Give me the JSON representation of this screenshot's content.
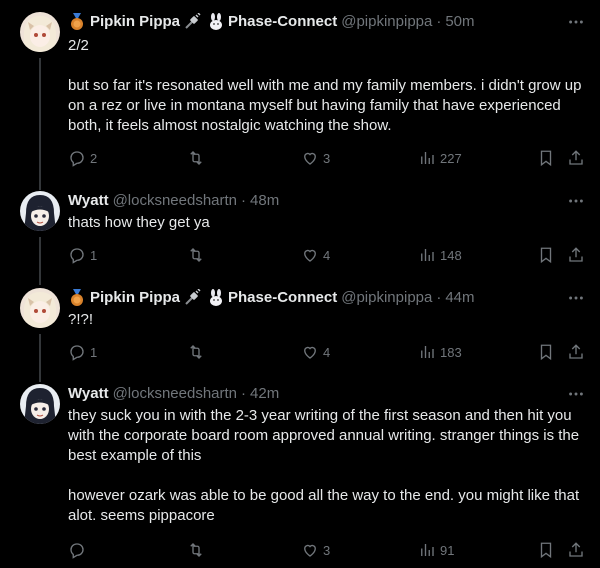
{
  "tweets": [
    {
      "author": "Pipkin Pippa",
      "affiliation": "Phase-Connect",
      "handle": "@pipkinpippa",
      "time": "50m",
      "lines": [
        "2/2",
        "",
        "but so far it's resonated well with me and my family members. i didn't grow up on a rez or live in montana myself but having family that have experienced both, it feels almost nostalgic watching the show."
      ],
      "replies": "2",
      "retweets": "",
      "likes": "3",
      "views": "227"
    },
    {
      "author": "Wyatt",
      "handle": "@locksneedshartn",
      "time": "48m",
      "lines": [
        "thats how they get ya"
      ],
      "replies": "1",
      "retweets": "",
      "likes": "4",
      "views": "148"
    },
    {
      "author": "Pipkin Pippa",
      "affiliation": "Phase-Connect",
      "handle": "@pipkinpippa",
      "time": "44m",
      "lines": [
        "?!?!"
      ],
      "replies": "1",
      "retweets": "",
      "likes": "4",
      "views": "183"
    },
    {
      "author": "Wyatt",
      "handle": "@locksneedshartn",
      "time": "42m",
      "lines": [
        "they suck you in with the 2-3 year writing of the first season and then hit you with the corporate board room approved annual writing. stranger things is the best example of this",
        "",
        "however ozark was able to be good all the way to the end. you might like that alot. seems pippacore"
      ],
      "replies": "",
      "retweets": "",
      "likes": "3",
      "views": "91"
    }
  ],
  "separator": "·",
  "icons": {
    "medal": "medal-emoji",
    "plug": "plug-emoji",
    "rabbit": "rabbit-emoji",
    "more": "more-icon",
    "reply": "reply-icon",
    "retweet": "retweet-icon",
    "like": "heart-icon",
    "views": "views-icon",
    "bookmark": "bookmark-icon",
    "share": "share-icon"
  },
  "colors": {
    "background": "#000000",
    "text": "#e7e9ea",
    "muted": "#71767b",
    "line": "#333639"
  }
}
